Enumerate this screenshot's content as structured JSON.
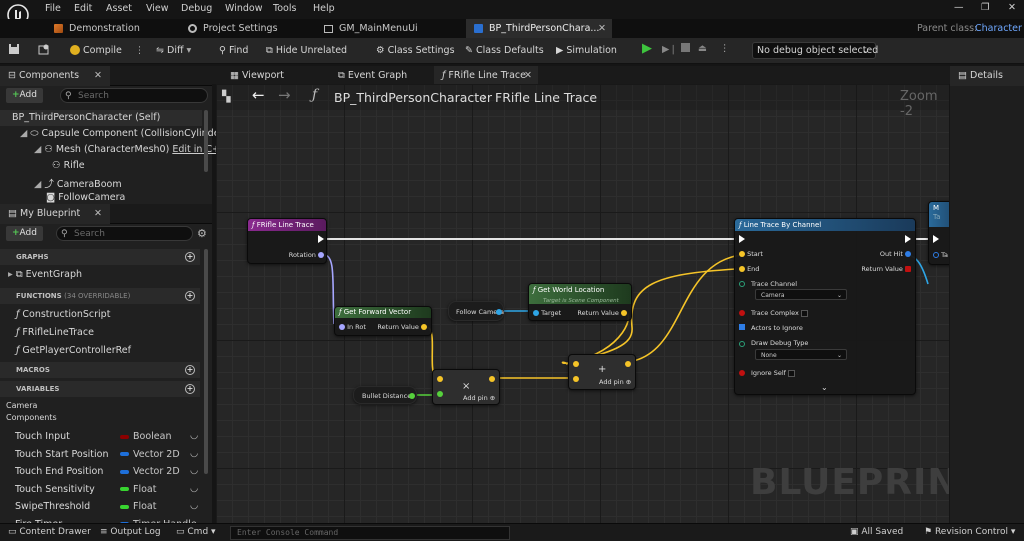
{
  "menu": [
    "File",
    "Edit",
    "Asset",
    "View",
    "Debug",
    "Window",
    "Tools",
    "Help"
  ],
  "window_controls": {
    "min": "—",
    "max": "❐",
    "close": "✕"
  },
  "doc_tabs": [
    {
      "label": "Demonstration"
    },
    {
      "label": "Project Settings"
    },
    {
      "label": "GM_MainMenuUi"
    },
    {
      "label": "BP_ThirdPersonChara..."
    }
  ],
  "parent_class": {
    "label": "Parent class:",
    "value": "Character"
  },
  "toolbar": {
    "compile": "Compile",
    "diff": "Diff",
    "find": "Find",
    "hide_unrelated": "Hide Unrelated",
    "class_settings": "Class Settings",
    "class_defaults": "Class Defaults",
    "simulation": "Simulation",
    "debug_select": "No debug object selected"
  },
  "components": {
    "title": "Components",
    "add": "Add",
    "search_placeholder": "Search",
    "items": [
      "BP_ThirdPersonCharacter (Self)",
      "Capsule Component (CollisionCylinder)",
      "Mesh (CharacterMesh0)",
      "Edit in C++",
      "Rifle",
      "CameraBoom",
      "FollowCamera"
    ]
  },
  "my_blueprint": {
    "title": "My Blueprint",
    "add": "Add",
    "search_placeholder": "Search",
    "graphs_label": "GRAPHS",
    "event_graph": "EventGraph",
    "functions_label": "FUNCTIONS",
    "functions_count": "(34 OVERRIDABLE)",
    "functions": [
      "ConstructionScript",
      "FRifleLineTrace",
      "GetPlayerControllerRef"
    ],
    "macros_label": "MACROS",
    "variables_label": "VARIABLES",
    "categories": [
      "Camera",
      "Components"
    ],
    "variables": [
      {
        "name": "Touch Input",
        "type": "Boolean",
        "color": "#8b0000"
      },
      {
        "name": "Touch Start Position",
        "type": "Vector 2D",
        "color": "#1e6fd9"
      },
      {
        "name": "Touch End Position",
        "type": "Vector 2D",
        "color": "#1e6fd9"
      },
      {
        "name": "Touch Sensitivity",
        "type": "Float",
        "color": "#38d430"
      },
      {
        "name": "SwipeThreshold",
        "type": "Float",
        "color": "#38d430"
      },
      {
        "name": "Fire Timer",
        "type": "Timer Handle",
        "color": "#1e6fd9"
      }
    ]
  },
  "editor_tabs": [
    "Viewport",
    "Event Graph",
    "FRifle Line Trace"
  ],
  "breadcrumb": {
    "root": "BP_ThirdPersonCharacter",
    "sep": "›",
    "current": "FRifle Line Trace"
  },
  "zoom": "Zoom -2",
  "watermark": "BLUEPRINT",
  "details_title": "Details",
  "nodes": {
    "entry": {
      "title": "FRifle Line Trace",
      "out": "Rotation"
    },
    "forward": {
      "title": "Get Forward Vector",
      "in": "In Rot",
      "out": "Return Value"
    },
    "follow_camera": {
      "title": "Follow Camera"
    },
    "world_loc": {
      "title": "Get World Location",
      "subtitle": "Target is Scene Component",
      "in": "Target",
      "out": "Return Value"
    },
    "bullet": {
      "title": "Bullet Distance"
    },
    "multiply": {
      "symbol": "×",
      "add_pin": "Add pin"
    },
    "add": {
      "symbol": "+",
      "add_pin": "Add pin"
    },
    "trace": {
      "title": "Line Trace By Channel",
      "start": "Start",
      "end": "End",
      "out_hit": "Out Hit",
      "return": "Return Value",
      "channel_label": "Trace Channel",
      "channel_value": "Camera",
      "trace_complex": "Trace Complex",
      "actors_ignore": "Actors to Ignore",
      "draw_debug": "Draw Debug Type",
      "draw_debug_value": "None",
      "ignore_self": "Ignore Self"
    },
    "partial": {
      "title": "M",
      "sub": "Ta",
      "pin": "Ta"
    }
  },
  "status": {
    "content_drawer": "Content Drawer",
    "output_log": "Output Log",
    "cmd": "Cmd",
    "console_placeholder": "Enter Console Command",
    "all_saved": "All Saved",
    "revision": "Revision Control"
  }
}
